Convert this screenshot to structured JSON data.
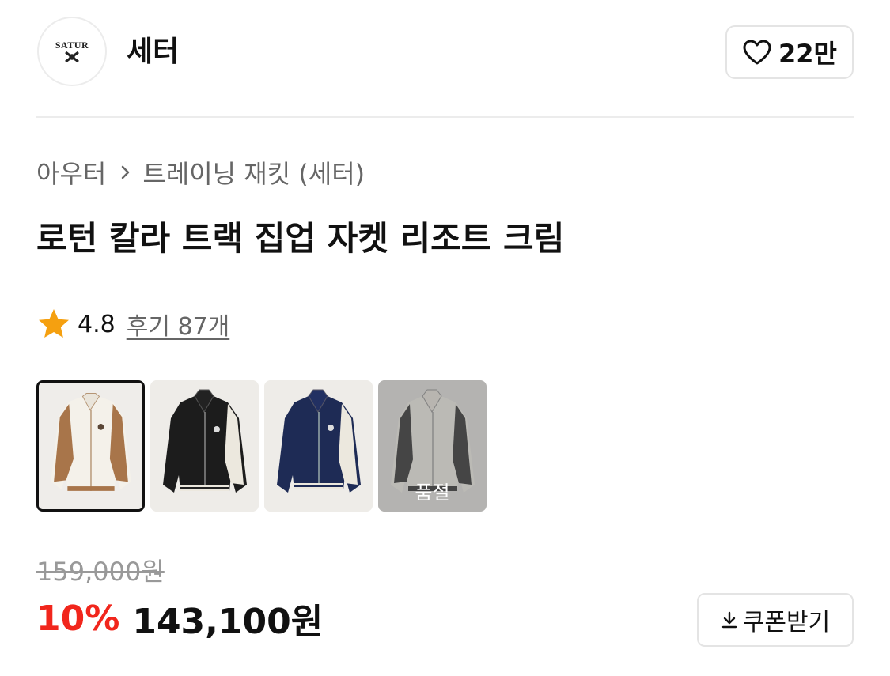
{
  "brand": {
    "logo_text": "SATUR",
    "name": "세터"
  },
  "like": {
    "count": "22만",
    "icon": "heart-icon"
  },
  "breadcrumb": {
    "items": [
      "아우터",
      "트레이닝 재킷 (세터)"
    ],
    "separator_icon": "chevron-right-icon"
  },
  "product": {
    "title": "로턴 칼라 트랙 집업 자켓 리조트 크림"
  },
  "rating": {
    "score": "4.8",
    "reviews_label": "후기 87개",
    "star_color": "#f5a010"
  },
  "thumbnails": [
    {
      "color": "cream/brown",
      "selected": true,
      "sold_out": false
    },
    {
      "color": "black/cream",
      "selected": false,
      "sold_out": false
    },
    {
      "color": "navy/cream",
      "selected": false,
      "sold_out": false
    },
    {
      "color": "cream/black",
      "selected": false,
      "sold_out": true,
      "label": "품절"
    }
  ],
  "price": {
    "original": "159,000원",
    "discount": "10%",
    "sale": "143,100원",
    "discount_color": "#f1261c"
  },
  "coupon": {
    "label": "쿠폰받기",
    "icon": "download-icon"
  }
}
